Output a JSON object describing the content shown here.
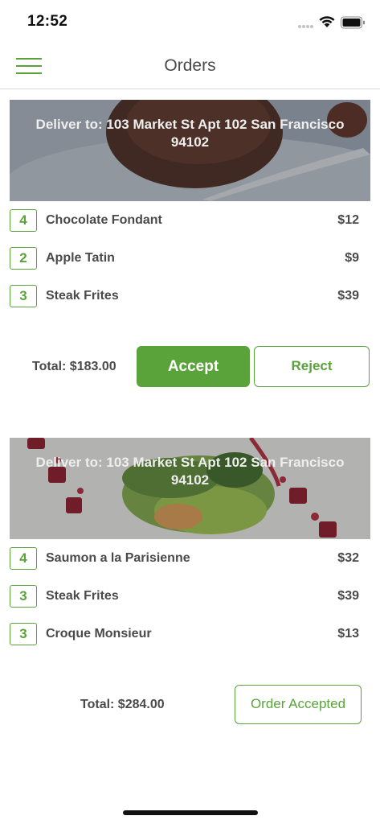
{
  "status_bar": {
    "time": "12:52",
    "icons": [
      "signal-dots-icon",
      "wifi-icon",
      "battery-icon"
    ]
  },
  "nav": {
    "title": "Orders",
    "menu_icon": "hamburger-menu-icon"
  },
  "colors": {
    "accent": "#5aa33b",
    "text": "#4a4a4a",
    "divider": "#d9d9d9"
  },
  "orders": [
    {
      "deliver_to": "Deliver to:  103 Market St Apt 102 San Francisco 94102",
      "items": [
        {
          "qty": "4",
          "name": "Chocolate Fondant",
          "price": "$12"
        },
        {
          "qty": "2",
          "name": "Apple Tatin",
          "price": "$9"
        },
        {
          "qty": "3",
          "name": "Steak Frites",
          "price": "$39"
        }
      ],
      "total": "Total: $183.00",
      "accept_label": "Accept",
      "reject_label": "Reject"
    },
    {
      "deliver_to": "Deliver to:  103 Market St Apt 102 San Francisco 94102",
      "items": [
        {
          "qty": "4",
          "name": "Saumon a la Parisienne",
          "price": "$32"
        },
        {
          "qty": "3",
          "name": "Steak Frites",
          "price": "$39"
        },
        {
          "qty": "3",
          "name": "Croque Monsieur",
          "price": "$13"
        }
      ],
      "total": "Total: $284.00",
      "status_label": "Order Accepted"
    }
  ]
}
